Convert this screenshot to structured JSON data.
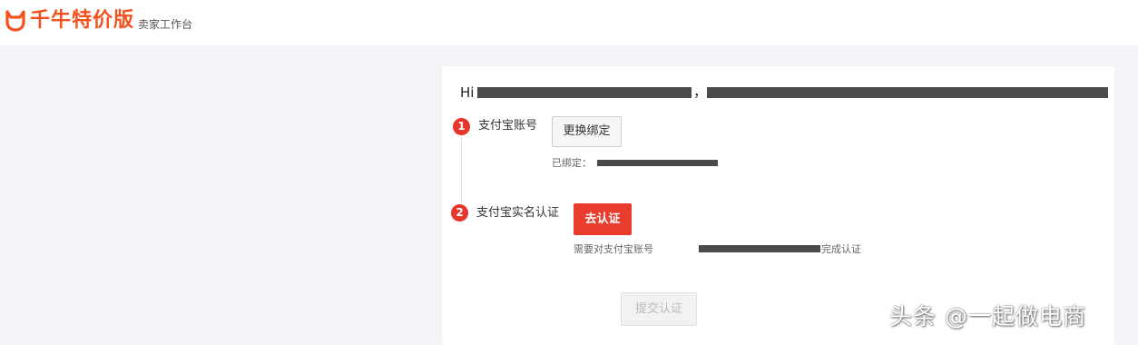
{
  "header": {
    "logo_text": "千牛特价版",
    "logo_subtitle": "卖家工作台"
  },
  "card": {
    "greeting_prefix": "Hi",
    "greeting_comma": "，",
    "steps": [
      {
        "number": "1",
        "label": "支付宝账号",
        "button_label": "更换绑定",
        "note_prefix": "已绑定："
      },
      {
        "number": "2",
        "label": "支付宝实名认证",
        "button_label": "去认证",
        "note_prefix": "需要对支付宝账号",
        "note_suffix": "完成认证"
      }
    ],
    "submit_label": "提交认证"
  },
  "watermark": "头条 @一起做电商",
  "colors": {
    "brand": "#f4511e",
    "step_badge": "#e8342a",
    "primary_button": "#e83c2c",
    "redaction": "#4a4a4a"
  }
}
